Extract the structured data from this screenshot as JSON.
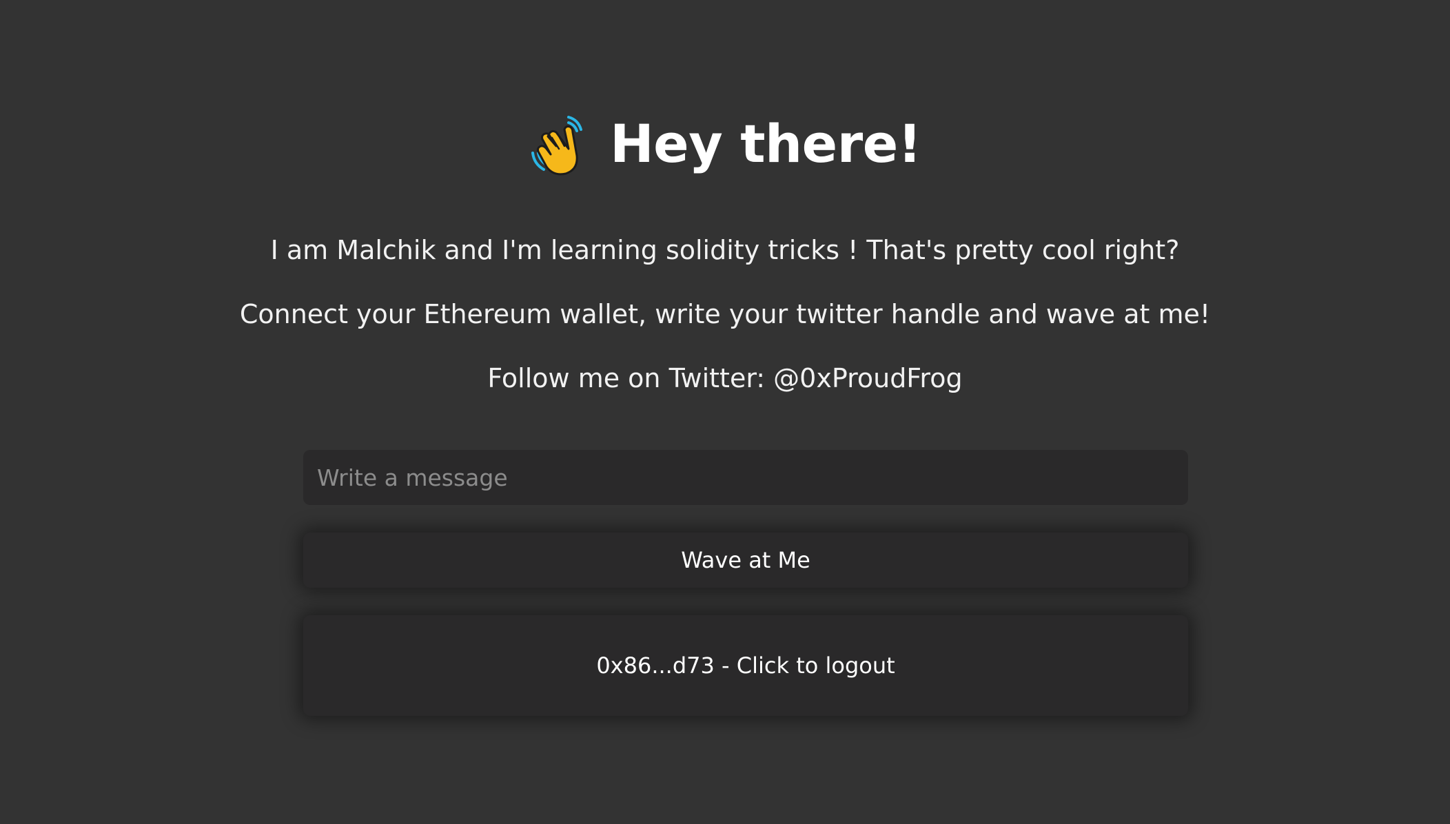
{
  "header": {
    "icon": "waving-hand-icon",
    "title": "Hey there!"
  },
  "intro": {
    "line1": "I am Malchik and I'm learning solidity tricks ! That's pretty cool right?",
    "line2": "Connect your Ethereum wallet, write your twitter handle and wave at me!",
    "line3": "Follow me on Twitter: @0xProudFrog"
  },
  "form": {
    "message_placeholder": "Write a message",
    "message_value": "",
    "wave_button_label": "Wave at Me",
    "logout_button_label": "0x86...d73 - Click to logout"
  },
  "colors": {
    "background": "#333333",
    "surface": "#2a292a",
    "text": "#ffffff",
    "placeholder": "#8c8c8c"
  }
}
